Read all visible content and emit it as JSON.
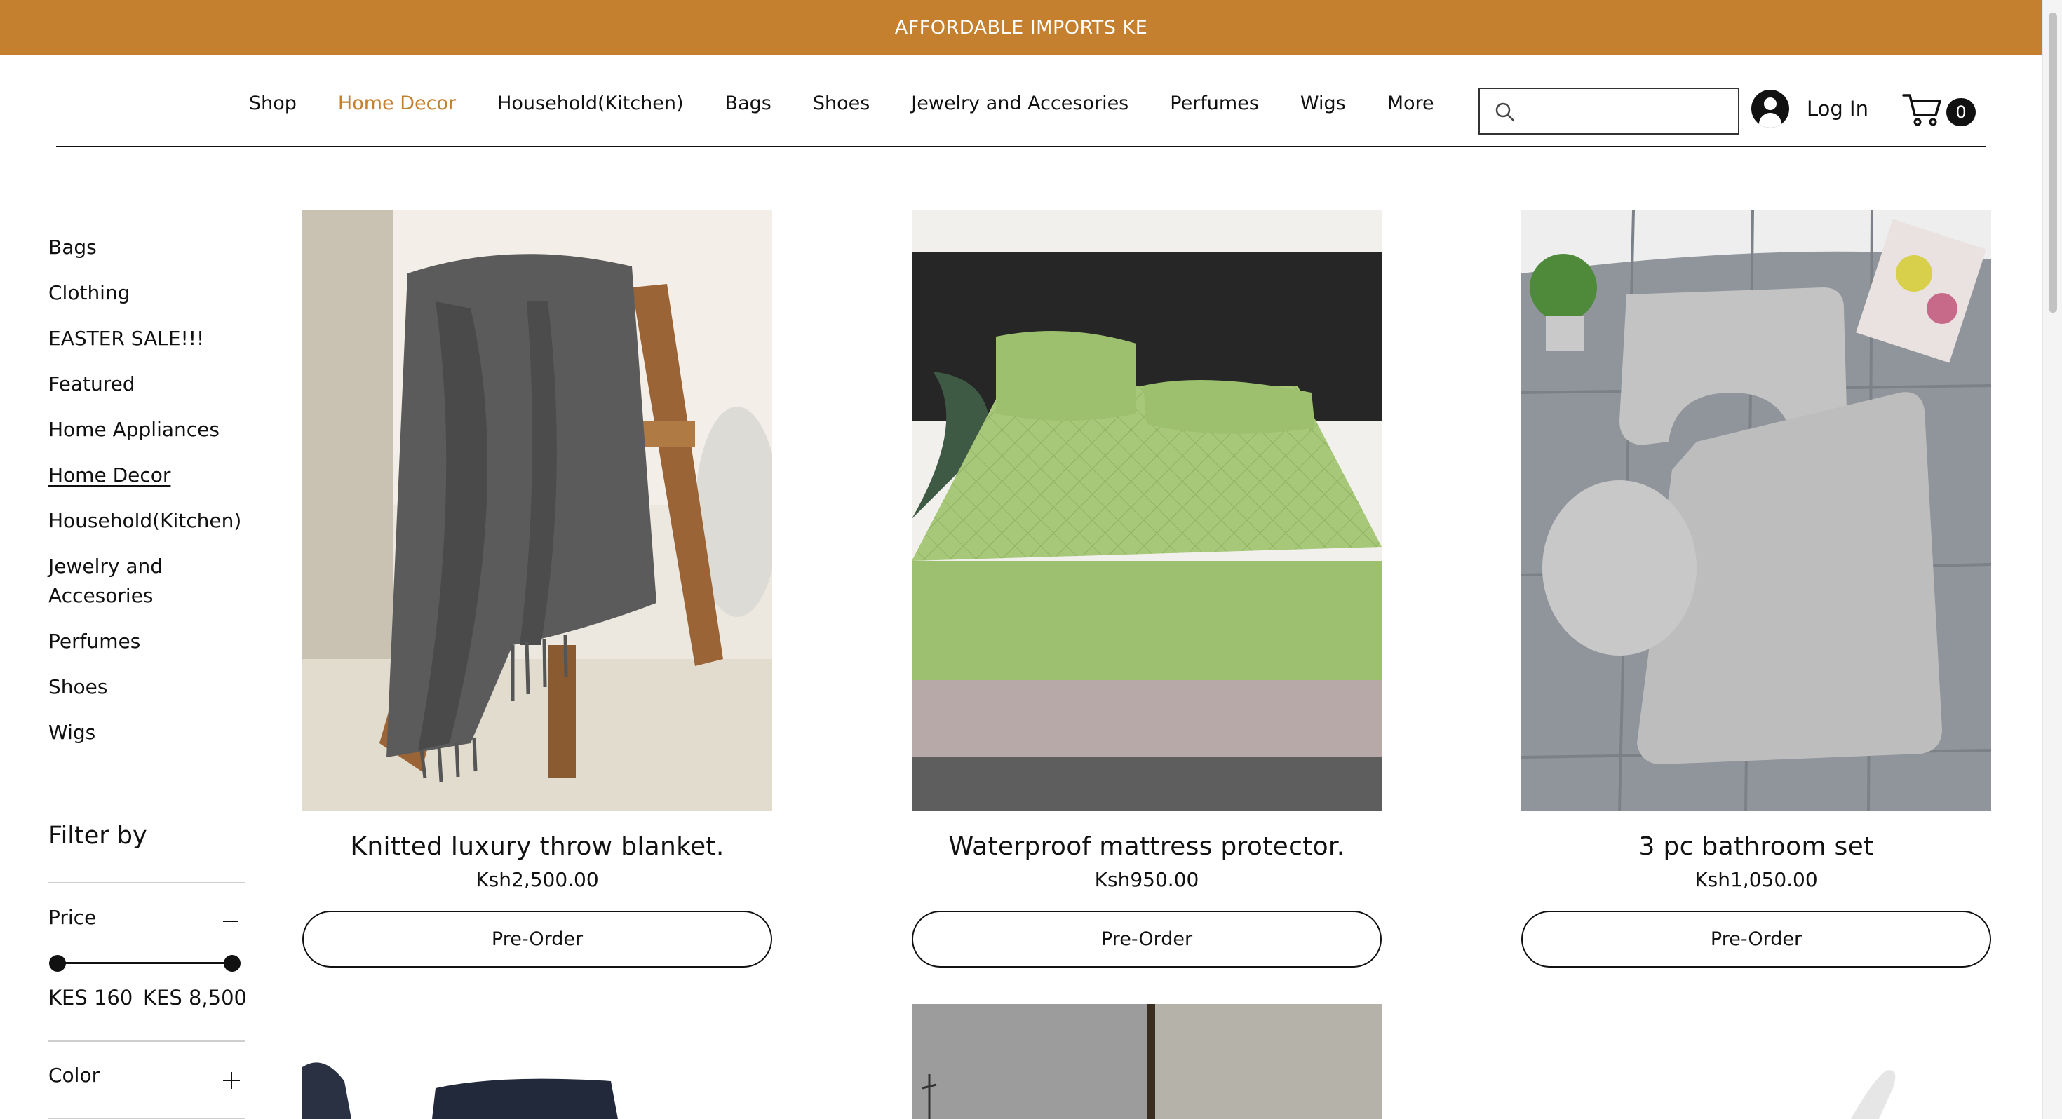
{
  "banner": {
    "text": "AFFORDABLE IMPORTS KE"
  },
  "nav": {
    "items": [
      {
        "label": "Shop",
        "active": false
      },
      {
        "label": "Home Decor",
        "active": true
      },
      {
        "label": "Household(Kitchen)",
        "active": false
      },
      {
        "label": "Bags",
        "active": false
      },
      {
        "label": "Shoes",
        "active": false
      },
      {
        "label": "Jewelry and Accesories",
        "active": false
      },
      {
        "label": "Perfumes",
        "active": false
      },
      {
        "label": "Wigs",
        "active": false
      },
      {
        "label": "More",
        "active": false
      }
    ]
  },
  "header": {
    "search": {
      "value": "",
      "placeholder": "",
      "icon": "search-icon"
    },
    "login_label": "Log In",
    "cart_count": "0",
    "accent_color": "#c47f2f"
  },
  "sidebar": {
    "categories": [
      "Bags",
      "Clothing",
      "EASTER SALE!!!",
      "Featured",
      "Home Appliances",
      "Home Decor",
      "Household(Kitchen)",
      "Jewelry and Accesories",
      "Perfumes",
      "Shoes",
      "Wigs"
    ],
    "current_category": "Home Decor",
    "filter_title": "Filter by",
    "price_label": "Price",
    "price_min": "KES 160",
    "price_max": "KES 8,500",
    "color_label": "Color"
  },
  "products": [
    {
      "name": "Knitted luxury throw blanket.",
      "price": "Ksh2,500.00",
      "button": "Pre-Order"
    },
    {
      "name": "Waterproof mattress protector.",
      "price": "Ksh950.00",
      "button": "Pre-Order"
    },
    {
      "name": "3 pc bathroom set",
      "price": "Ksh1,050.00",
      "button": "Pre-Order"
    }
  ]
}
